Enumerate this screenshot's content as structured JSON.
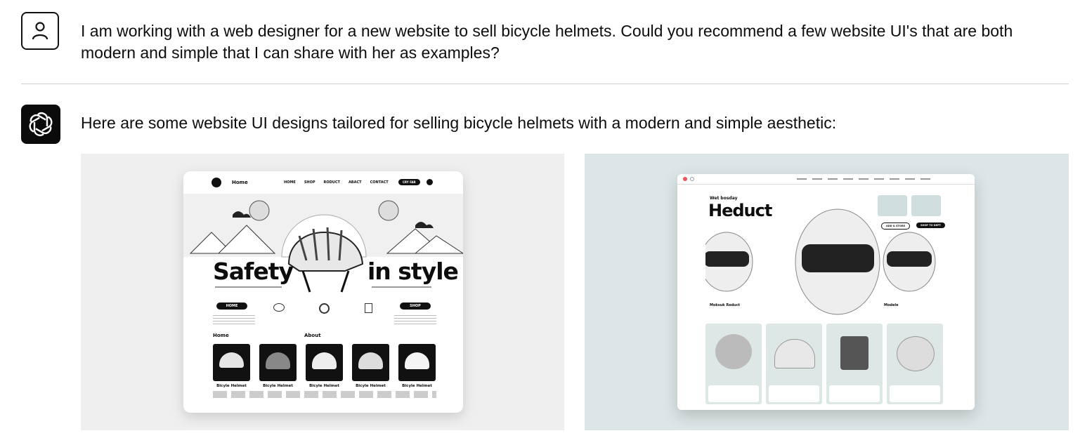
{
  "conversation": {
    "user_message": "I am working with a web designer for a new website to sell bicycle helmets. Could you recommend a few website UI's that are both modern and simple that I can share with her as examples?",
    "assistant_message": "Here are some website UI designs tailored for selling bicycle helmets with a modern and simple aesthetic:"
  },
  "image1": {
    "nav_home": "Home",
    "nav_items": [
      "HOME",
      "SHOP",
      "RODUCT",
      "ABACT",
      "CONTACT"
    ],
    "nav_button": "CRY FAR",
    "hero_left": "Safety",
    "hero_right": "in style",
    "btn_home": "HOME",
    "btn_shop": "SHOP",
    "section_home": "Home",
    "section_about": "About",
    "product_name": "Bicyle Helmet",
    "product_names": [
      "Bicyle Helmet",
      "Bicyle Helmet",
      "Bicyle Helmet",
      "Bicyle Helmet",
      "Bicyle Helmet"
    ]
  },
  "image2": {
    "subtitle": "Wet bosday",
    "brand": "Heduct",
    "left_label": "Moksuk Reduct",
    "right_label": "Modele",
    "btn_a": "ADD & STORE",
    "btn_b": "SHOP TO DEPT"
  }
}
